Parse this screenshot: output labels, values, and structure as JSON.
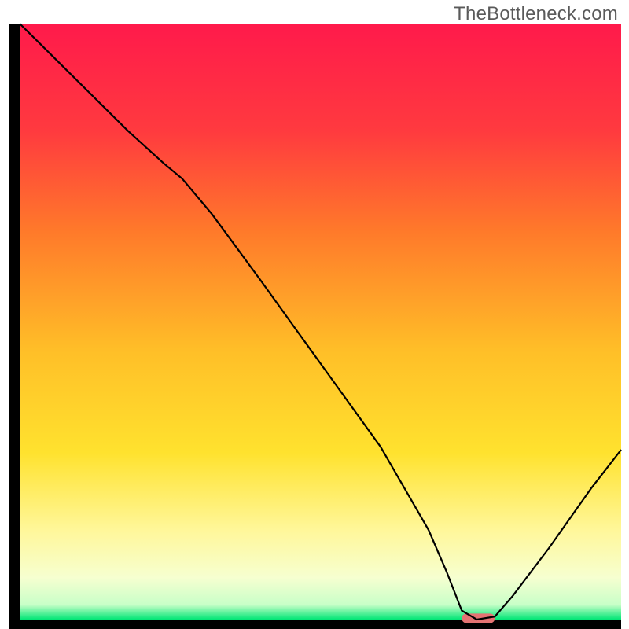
{
  "watermark": "TheBottleneck.com",
  "chart_data": {
    "type": "line",
    "title": "",
    "xlabel": "",
    "ylabel": "",
    "xlim": [
      0,
      100
    ],
    "ylim": [
      0,
      100
    ],
    "grid": false,
    "legend": false,
    "gradient_stops": [
      {
        "offset": 0.0,
        "color": "#ff1a4b"
      },
      {
        "offset": 0.18,
        "color": "#ff3a3f"
      },
      {
        "offset": 0.35,
        "color": "#ff7a2a"
      },
      {
        "offset": 0.55,
        "color": "#ffbf28"
      },
      {
        "offset": 0.72,
        "color": "#ffe22e"
      },
      {
        "offset": 0.85,
        "color": "#fff79a"
      },
      {
        "offset": 0.93,
        "color": "#f6ffd0"
      },
      {
        "offset": 0.975,
        "color": "#c8ffc8"
      },
      {
        "offset": 1.0,
        "color": "#00e676"
      }
    ],
    "marker": {
      "x_start": 73.5,
      "x_end": 79.0,
      "y": 0.2,
      "color": "#e57373",
      "thickness": 1.6
    },
    "series": [
      {
        "name": "curve",
        "color": "#000000",
        "x": [
          0.0,
          3.0,
          10.0,
          18.0,
          24.0,
          27.0,
          32.0,
          40.0,
          50.0,
          60.0,
          68.0,
          71.0,
          73.5,
          76.0,
          79.0,
          82.0,
          88.0,
          95.0,
          100.0
        ],
        "y": [
          100.0,
          97.0,
          90.0,
          82.0,
          76.5,
          74.0,
          68.0,
          57.0,
          43.0,
          29.0,
          15.0,
          8.0,
          1.5,
          0.0,
          0.5,
          4.0,
          12.0,
          22.0,
          28.5
        ]
      }
    ]
  }
}
